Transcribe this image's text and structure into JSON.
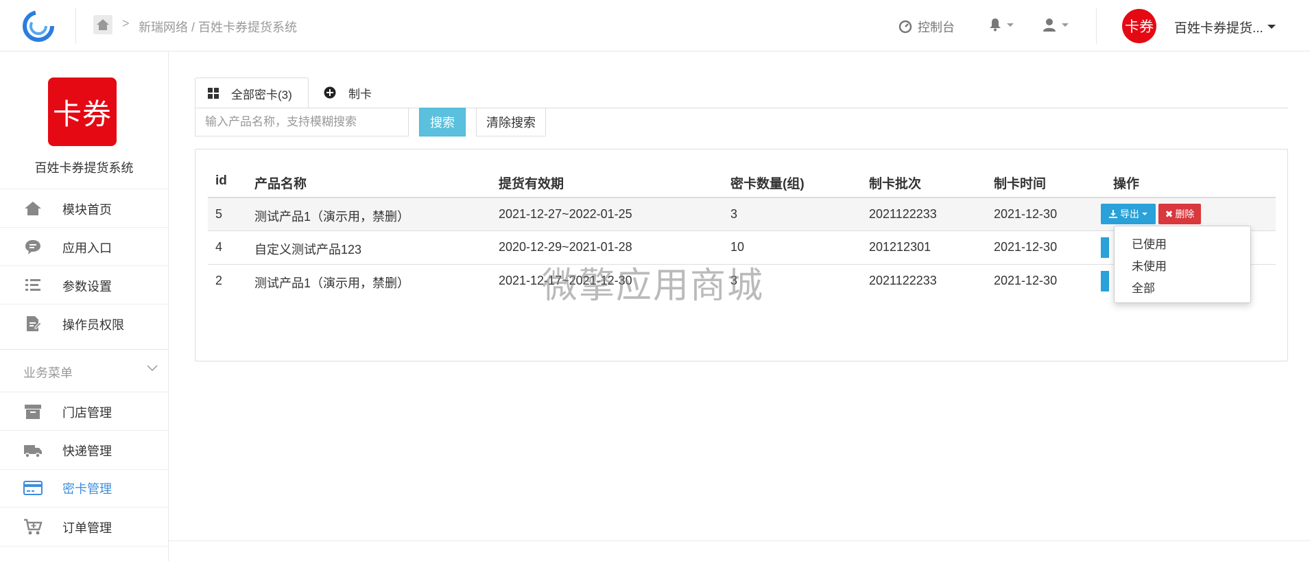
{
  "header": {
    "breadcrumb": "新瑞网络 / 百姓卡券提货系统",
    "console_label": "控制台",
    "avatar_text": "卡券",
    "user_name": "百姓卡券提货..."
  },
  "sidebar": {
    "brand_logo_text": "卡券",
    "brand_name": "百姓卡券提货系统",
    "items_top": [
      {
        "label": "模块首页",
        "icon": "home-icon"
      },
      {
        "label": "应用入口",
        "icon": "chat-icon"
      },
      {
        "label": "参数设置",
        "icon": "list-icon"
      },
      {
        "label": "操作员权限",
        "icon": "doc-edit-icon"
      }
    ],
    "group_label": "业务菜单",
    "items_business": [
      {
        "label": "门店管理",
        "icon": "archive-icon"
      },
      {
        "label": "快递管理",
        "icon": "truck-icon"
      },
      {
        "label": "密卡管理",
        "icon": "credit-card-icon",
        "active": true
      },
      {
        "label": "订单管理",
        "icon": "cart-icon"
      }
    ]
  },
  "tabs": [
    {
      "label": "全部密卡(3)",
      "active": true
    },
    {
      "label": "制卡",
      "active": false
    }
  ],
  "search": {
    "placeholder": "输入产品名称，支持模糊搜索",
    "search_label": "搜索",
    "clear_label": "清除搜索"
  },
  "table": {
    "columns": [
      "id",
      "产品名称",
      "提货有效期",
      "密卡数量(组)",
      "制卡批次",
      "制卡时间",
      "操作"
    ],
    "rows": [
      [
        "5",
        "测试产品1（演示用，禁删）",
        "2021-12-27~2022-01-25",
        "3",
        "2021122233",
        "2021-12-30"
      ],
      [
        "4",
        "自定义测试产品123",
        "2020-12-29~2021-01-28",
        "10",
        "201212301",
        "2021-12-30"
      ],
      [
        "2",
        "测试产品1（演示用，禁删）",
        "2021-12-17~2021-12-30",
        "3",
        "2021122233",
        "2021-12-30"
      ]
    ],
    "export_label": "导出",
    "delete_label": "删除"
  },
  "export_menu": [
    "已使用",
    "未使用",
    "全部"
  ],
  "watermark": "微擎应用商城",
  "colors": {
    "brand_red": "#e50914",
    "accent_blue": "#3c8dde",
    "info": "#5bc0de",
    "danger": "#d9383d"
  }
}
